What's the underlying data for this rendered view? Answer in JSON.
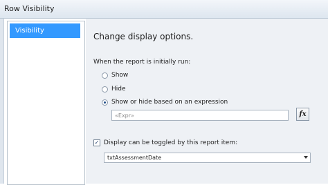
{
  "window": {
    "title": "Row Visibility"
  },
  "sidebar": {
    "items": [
      {
        "label": "Visibility",
        "selected": true
      }
    ]
  },
  "main": {
    "heading": "Change display options.",
    "initial_label": "When the report is initially run:",
    "options": [
      {
        "label": "Show",
        "checked": false
      },
      {
        "label": "Hide",
        "checked": false
      },
      {
        "label": "Show or hide based on an expression",
        "checked": true
      }
    ],
    "expression": {
      "value": "«Expr»",
      "button_label": "fx"
    },
    "toggle": {
      "label": "Display can be toggled by this report item:",
      "checked": true
    },
    "report_item": {
      "selected": "txtAssessmentDate"
    }
  },
  "colors": {
    "selection": "#3399ff",
    "panel": "#eef1f5"
  }
}
